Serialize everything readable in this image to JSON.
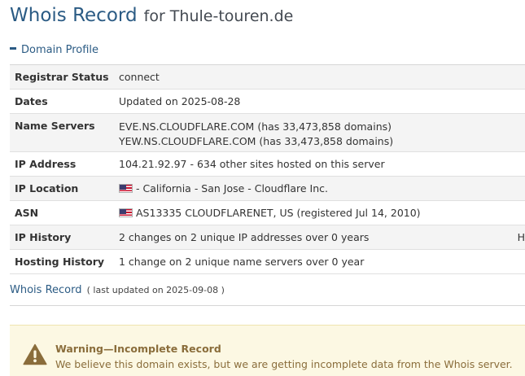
{
  "header": {
    "title": "Whois Record",
    "subtitle": "for Thule-touren.de"
  },
  "domain_profile": {
    "heading": "Domain Profile",
    "rows": [
      {
        "label": "Registrar Status",
        "value": "connect"
      },
      {
        "label": "Dates",
        "value": "Updated on 2025-08-28"
      },
      {
        "label": "Name Servers",
        "lines": [
          "EVE.NS.CLOUDFLARE.COM (has 33,473,858 domains)",
          "YEW.NS.CLOUDFLARE.COM (has 33,473,858 domains)"
        ]
      },
      {
        "label": "IP Address",
        "value": "104.21.92.97 - 634 other sites hosted on this server"
      },
      {
        "label": "IP Location",
        "value": "- California - San Jose - Cloudflare Inc.",
        "flag": "us-flag"
      },
      {
        "label": "ASN",
        "value": "AS13335 CLOUDFLARENET, US (registered Jul 14, 2010)",
        "flag": "us-flag"
      },
      {
        "label": "IP History",
        "value": "2 changes on 2 unique IP addresses over 0 years",
        "trail": "H"
      },
      {
        "label": "Hosting History",
        "value": "1 change on 2 unique name servers over 0 year"
      }
    ]
  },
  "whois_section": {
    "heading": "Whois Record",
    "note": "( last updated on 2025-09-08 )"
  },
  "warning": {
    "title": "Warning—Incomplete Record",
    "text": "We believe this domain exists, but we are getting incomplete data from the Whois server.",
    "icon": "warning-triangle-icon"
  },
  "colors": {
    "heading_blue": "#2b5b84",
    "warning_bg": "#fcf8e3",
    "warning_text": "#8a6d3b",
    "warning_icon": "#8a6d3b"
  }
}
